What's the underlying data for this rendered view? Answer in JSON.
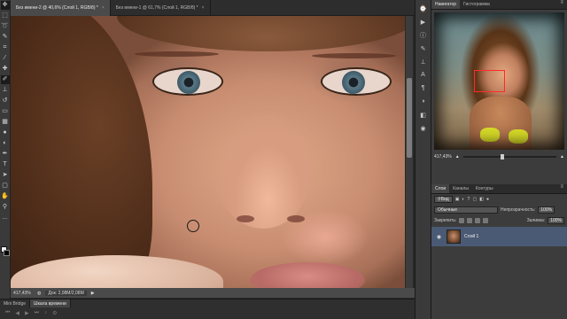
{
  "document_tabs": [
    {
      "title": "Без имени-2 @ 40,6% (Слой 1, RGB/8) *",
      "active": true
    },
    {
      "title": "Без имени-1 @ 61,7% (Слой 1, RGB/8) *",
      "active": false
    }
  ],
  "status": {
    "zoom": "417,43%",
    "doc": "Док: 2,08M/2,08M"
  },
  "bottom_tabs": [
    "Mini Bridge",
    "Шкала времени"
  ],
  "panel_tabs_top": [
    "Навигатор",
    "Гистограмма"
  ],
  "navigator": {
    "zoom": "417,43%"
  },
  "panel_tabs_layers": [
    "Слои",
    "Каналы",
    "Контуры"
  ],
  "layers": {
    "filter_label": "Вид",
    "blend_mode": "Обычные",
    "opacity_label": "Непрозрачность:",
    "opacity_value": "100%",
    "lock_label": "Закрепить:",
    "fill_label": "Заливка:",
    "fill_value": "100%",
    "layer_name": "Слой 1"
  },
  "colors": {
    "foreground": "#f0f0f0",
    "background": "#000000",
    "navigator_box": "#ff2a2a",
    "selected_layer": "#4a5a74"
  }
}
